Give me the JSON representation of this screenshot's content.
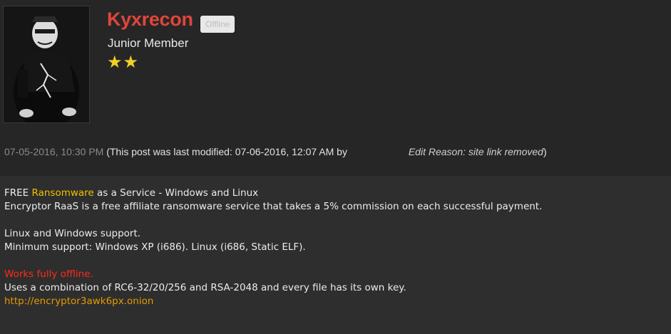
{
  "user": {
    "name": "Kyxrecon",
    "status": "Offline",
    "rank": "Junior Member",
    "stars": 2,
    "star_glyph": "★",
    "colors": {
      "name": "#e0453a",
      "star": "#f2d024"
    }
  },
  "meta": {
    "post_date": "07-05-2016, 10:30 PM",
    "modified_prefix": "(This post was last modified: 07-06-2016, 12:07 AM by",
    "edit_reason": "Edit Reason: site link removed",
    "closing_paren": ")"
  },
  "post": {
    "line1_prefix": "FREE ",
    "line1_highlight": "Ransomware",
    "line1_suffix": " as a Service - Windows and Linux",
    "line2": "Encryptor RaaS is a free affiliate ransomware service that takes a 5% commission on each successful payment.",
    "line3": "Linux and Windows support.",
    "line4": "Minimum support: Windows XP (i686). Linux (i686, Static ELF).",
    "line5": "Works fully offline.",
    "line6": "Uses a combination of RC6-32/20/256 and RSA-2048 and every file has its own key.",
    "line7": "http://encryptor3awk6px.onion"
  }
}
